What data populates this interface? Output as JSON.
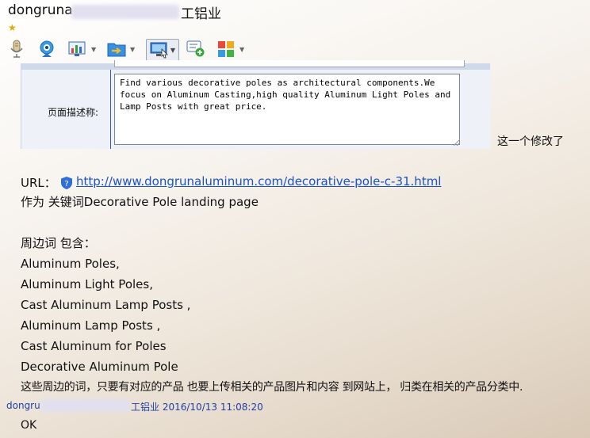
{
  "window": {
    "title_prefix": "dongruna",
    "title_suffix": "工铝业",
    "star_icon": "star-icon"
  },
  "toolbar": {
    "buttons": [
      {
        "name": "microphone-button",
        "icon": "microphone-icon"
      },
      {
        "name": "webcam-button",
        "icon": "webcam-icon"
      },
      {
        "name": "chart-tool-button",
        "icon": "chart-icon"
      },
      {
        "name": "file-send-button",
        "icon": "folder-arrow-icon"
      },
      {
        "name": "screen-share-button",
        "icon": "screen-icon"
      },
      {
        "name": "add-message-button",
        "icon": "message-add-icon"
      },
      {
        "name": "apps-button",
        "icon": "apps-grid-icon"
      }
    ]
  },
  "form": {
    "label": "页面描述称:",
    "description": "Find various decorative poles as architectural components.We focus on Aluminum Casting,high quality Aluminum Light Poles and Lamp Posts with great price.",
    "note": "这一个修改了"
  },
  "message": {
    "url_label": "URL：",
    "url": "http://www.dongrunaluminum.com/decorative-pole-c-31.html",
    "keyword_line": "作为 关键词Decorative Pole     landing page",
    "related_heading": "周边词 包含：",
    "related_terms": [
      "Aluminum Poles,",
      "Aluminum Light Poles,",
      "Cast Aluminum Lamp Posts ,",
      "Aluminum Lamp Posts ,",
      "Cast Aluminum for Poles",
      "Decorative Aluminum Pole"
    ],
    "instruction": "这些周边的词，只要有对应的产品 也要上传相关的产品图片和内容  到网站上， 归类在相关的产品分类中."
  },
  "reply": {
    "sender_prefix": "dongru",
    "sender_suffix": "工铝业",
    "timestamp": "2016/10/13 11:08:20",
    "text": "OK"
  }
}
